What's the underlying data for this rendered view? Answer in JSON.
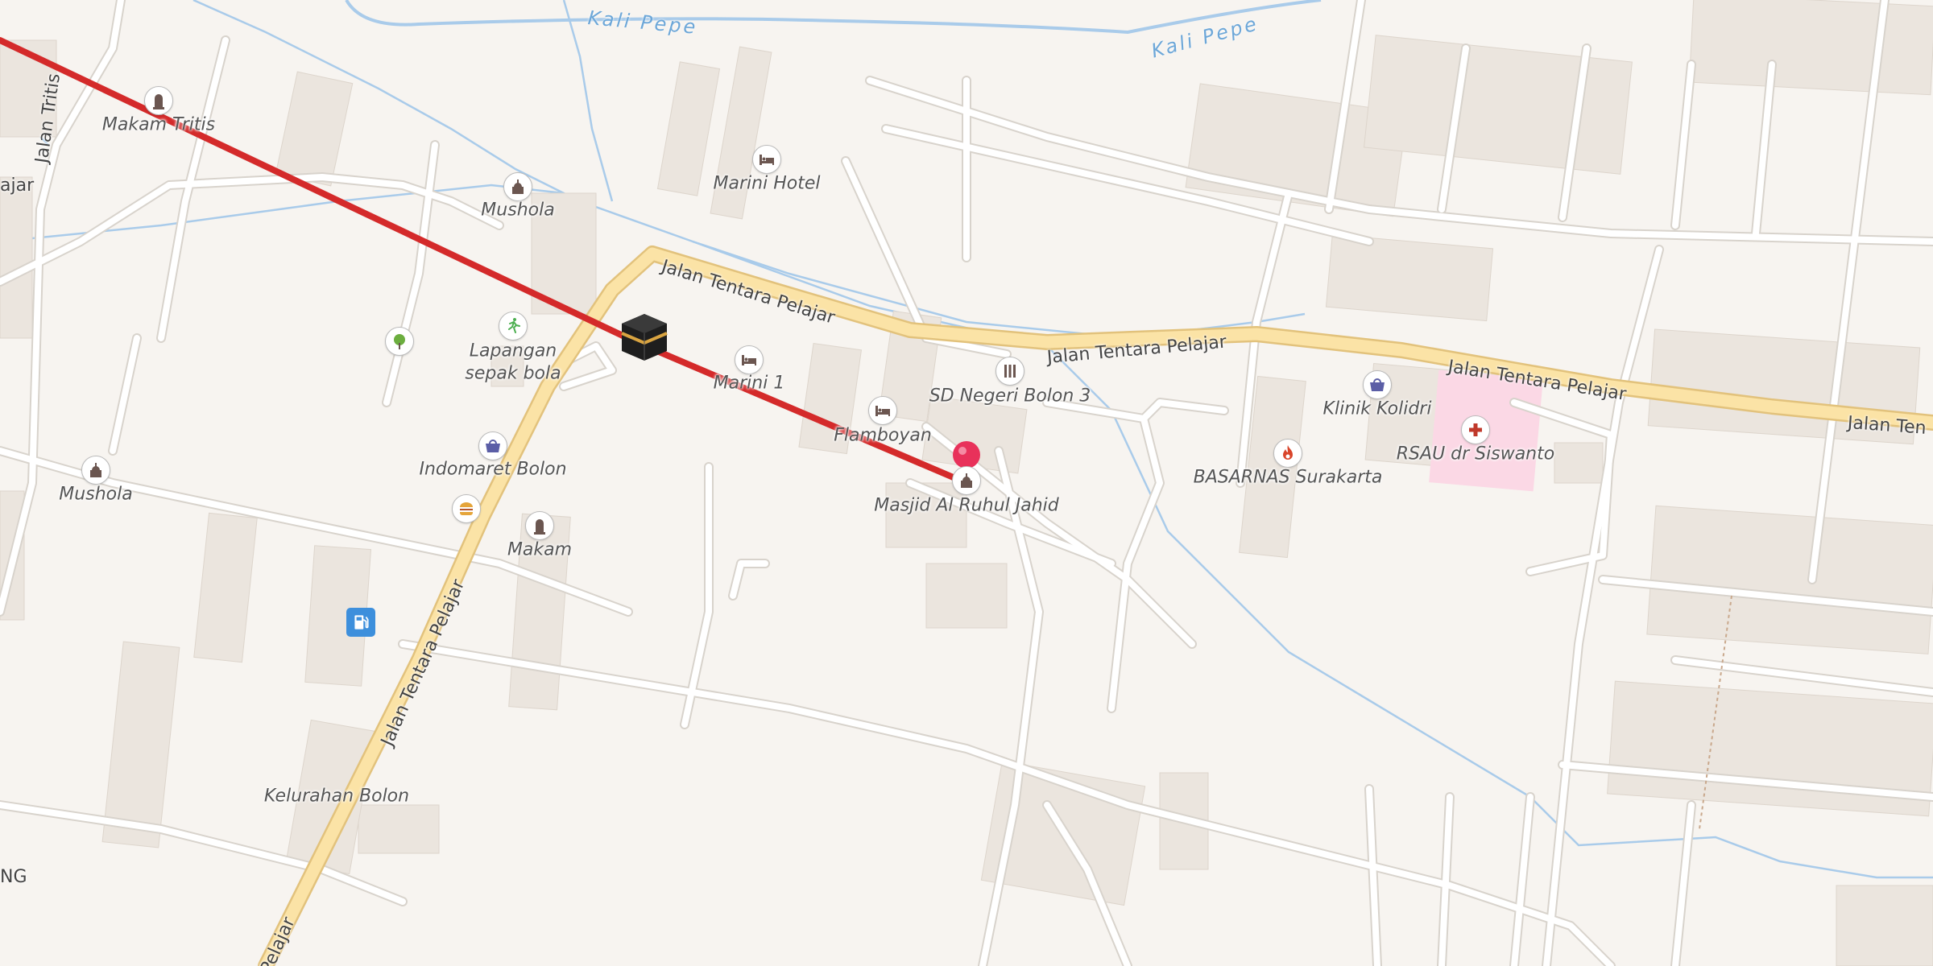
{
  "map": {
    "colors": {
      "background": "#f7f4f0",
      "road": "#ffffff",
      "road_casing": "#d8d3cc",
      "primary_road": "#fbe3a6",
      "primary_casing": "#e2c27c",
      "water": "#a9cbea",
      "building": "#ebe5de",
      "route": "#d42a2a",
      "hospital_area": "#fbd8e5",
      "marker": "#e8315a"
    },
    "roads": {
      "main_east_1": "Jalan Tentara Pelajar",
      "main_east_2": "Jalan Tentara Pelajar",
      "main_east_3": "Jalan Tentara Pelajar",
      "main_east_4": "Jalan Ten",
      "main_south": "Jalan Tentara Pelajar",
      "main_south_lower": "Pelajar",
      "tritis": "Jalan Tritis",
      "left_partial": "ajar",
      "edge_ng": "NG"
    },
    "waterways": {
      "river_1": "Kali Pepe",
      "river_2": "Kali Pepe"
    },
    "places": [
      {
        "id": "makam-tritis",
        "label": "Makam Tritis",
        "icon": "cemetery-icon"
      },
      {
        "id": "mushola-1",
        "label": "Mushola",
        "icon": "mosque-icon"
      },
      {
        "id": "marini-hotel",
        "label": "Marini Hotel",
        "icon": "hotel-icon"
      },
      {
        "id": "lapangan",
        "label": "Lapangan sepak bola",
        "icon": "soccer-icon"
      },
      {
        "id": "park",
        "label": "",
        "icon": "tree-icon"
      },
      {
        "id": "marini-1",
        "label": "Marini 1",
        "icon": "hotel-icon"
      },
      {
        "id": "flamboyan",
        "label": "Flamboyan",
        "icon": "hotel-icon"
      },
      {
        "id": "sd-negeri",
        "label": "SD Negeri Bolon 3",
        "icon": "school-icon"
      },
      {
        "id": "masjid",
        "label": "Masjid Al Ruhul Jahid",
        "icon": "mosque-icon"
      },
      {
        "id": "indomaret",
        "label": "Indomaret Bolon",
        "icon": "shop-basket-icon"
      },
      {
        "id": "mushola-2",
        "label": "Mushola",
        "icon": "mosque-icon"
      },
      {
        "id": "fastfood",
        "label": "",
        "icon": "burger-icon"
      },
      {
        "id": "makam",
        "label": "Makam",
        "icon": "cemetery-icon"
      },
      {
        "id": "fuel",
        "label": "",
        "icon": "fuel-icon"
      },
      {
        "id": "klinik",
        "label": "Klinik Kolidri",
        "icon": "shop-basket-icon"
      },
      {
        "id": "basarnas",
        "label": "BASARNAS Surakarta",
        "icon": "fire-station-icon"
      },
      {
        "id": "rsau",
        "label": "RSAU dr Siswanto",
        "icon": "hospital-icon"
      },
      {
        "id": "kelurahan",
        "label": "Kelurahan Bolon",
        "icon": ""
      }
    ],
    "markers": {
      "kaaba": "kaaba-icon",
      "destination": "map-pin-icon"
    }
  }
}
